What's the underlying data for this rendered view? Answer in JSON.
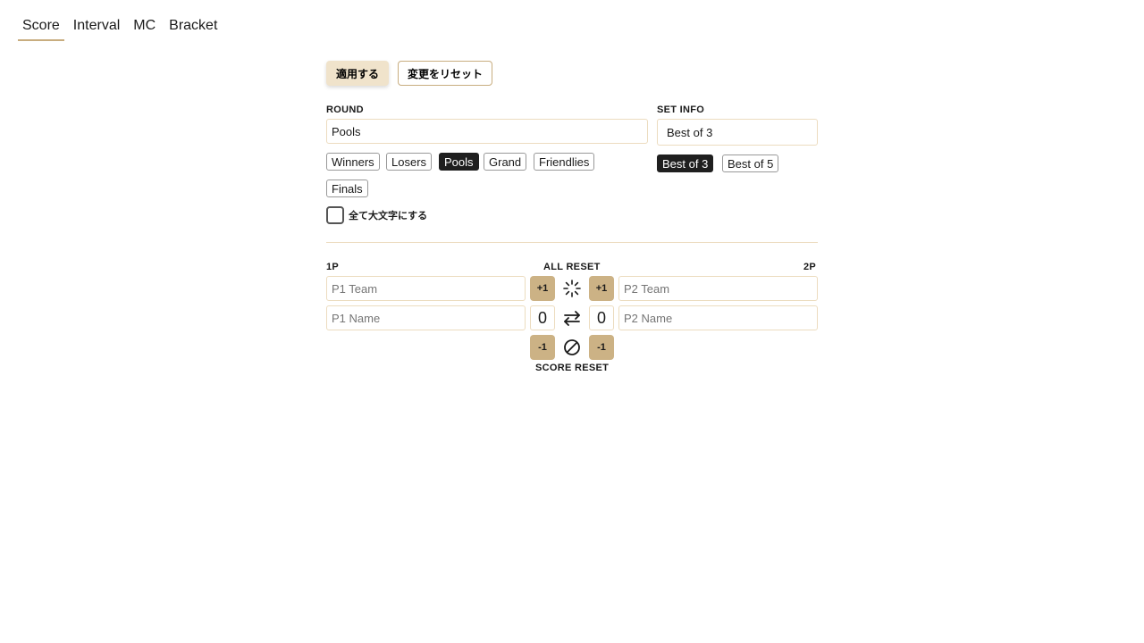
{
  "tabs": [
    {
      "label": "Score",
      "active": true
    },
    {
      "label": "Interval",
      "active": false
    },
    {
      "label": "MC",
      "active": false
    },
    {
      "label": "Bracket",
      "active": false
    }
  ],
  "actions": {
    "apply_label": "適用する",
    "reset_changes_label": "変更をリセット"
  },
  "round": {
    "label": "ROUND",
    "value": "Pools",
    "presets": [
      "Winners",
      "Losers",
      "Pools",
      "Grand",
      "Friendlies",
      "Finals"
    ],
    "selected": "Pools"
  },
  "set_info": {
    "label": "SET INFO",
    "value": "Best of 3",
    "presets": [
      "Best of 3",
      "Best of 5"
    ],
    "selected": "Best of 3"
  },
  "uppercase_option": {
    "label": "全て大文字にする",
    "checked": false
  },
  "scoreboard": {
    "p1_label": "1P",
    "p2_label": "2P",
    "all_reset_label": "ALL RESET",
    "score_reset_label": "SCORE RESET",
    "plus_label": "+1",
    "minus_label": "-1",
    "p1_team_placeholder": "P1 Team",
    "p1_name_placeholder": "P1 Name",
    "p2_team_placeholder": "P2 Team",
    "p2_name_placeholder": "P2 Name",
    "p1_score": "0",
    "p2_score": "0"
  },
  "icons": {
    "all_reset": "loader-icon",
    "swap": "swap-arrows-icon",
    "score_reset": "slash-circle-icon"
  },
  "colors": {
    "accent": "#c8ad7f",
    "apply_bg": "#f0e3cb",
    "score_button_bg": "#ccb285",
    "field_border": "#ecdcbf",
    "chip_selected": "#1f1f1f"
  }
}
